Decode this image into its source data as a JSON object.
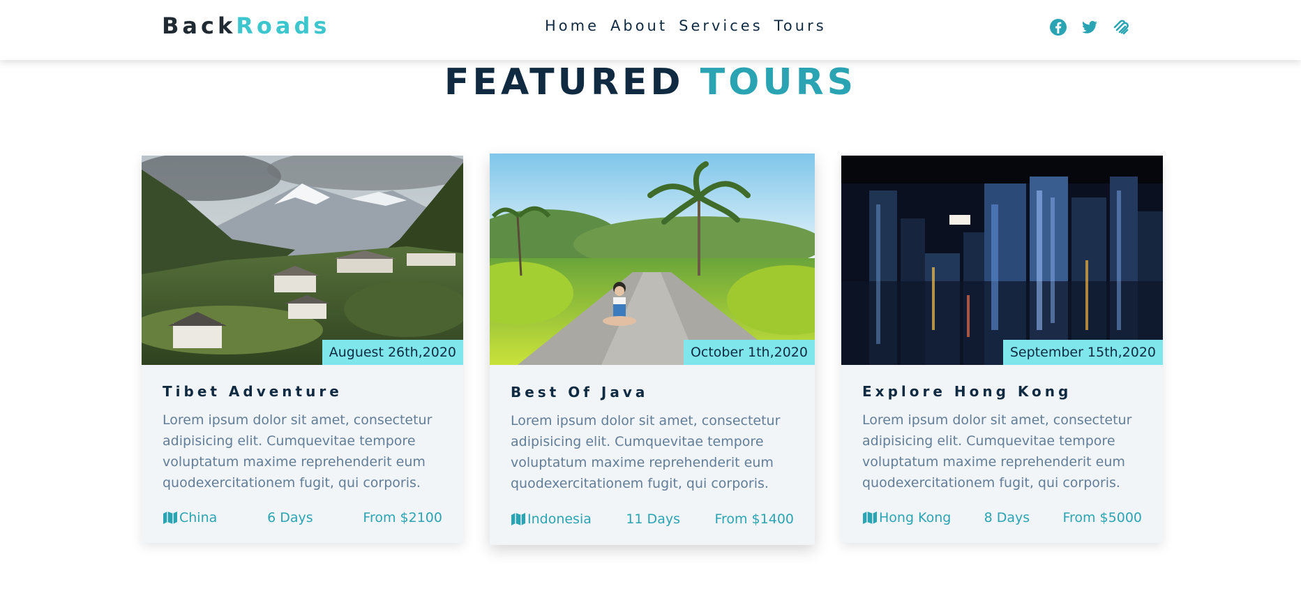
{
  "brand": {
    "part1": "Back",
    "part2": "Roads"
  },
  "nav": {
    "links": [
      "Home",
      "About",
      "Services",
      "Tours"
    ]
  },
  "social": [
    "facebook-icon",
    "twitter-icon",
    "squarespace-icon"
  ],
  "section": {
    "title_part1": "FEATURED",
    "title_part2": "TOURS"
  },
  "tours": [
    {
      "date": "Auguest 26th,2020",
      "title": "Tibet Adventure",
      "text": "Lorem ipsum dolor sit amet, consectetur adipisicing elit. Cumquevitae tempore voluptatum maxime reprehenderit eum quodexercitationem fugit, qui corporis.",
      "country": "China",
      "duration": "6 Days",
      "price": "From $2100",
      "image": "mountain-village-photo"
    },
    {
      "date": "October 1th,2020",
      "title": "Best Of Java",
      "text": "Lorem ipsum dolor sit amet, consectetur adipisicing elit. Cumquevitae tempore voluptatum maxime reprehenderit eum quodexercitationem fugit, qui corporis.",
      "country": "Indonesia",
      "duration": "11 Days",
      "price": "From $1400",
      "image": "tropical-road-photo"
    },
    {
      "date": "September 15th,2020",
      "title": "Explore Hong Kong",
      "text": "Lorem ipsum dolor sit amet, consectetur adipisicing elit. Cumquevitae tempore voluptatum maxime reprehenderit eum quodexercitationem fugit, qui corporis.",
      "country": "Hong Kong",
      "duration": "8 Days",
      "price": "From $5000",
      "image": "night-city-photo"
    }
  ],
  "colors": {
    "accent": "#2aa4b3",
    "logo_accent": "#3ec6cf",
    "dark": "#102a42",
    "text": "#617d98",
    "date_bg": "#7fe7ec",
    "card_bg": "#f1f5f8"
  }
}
